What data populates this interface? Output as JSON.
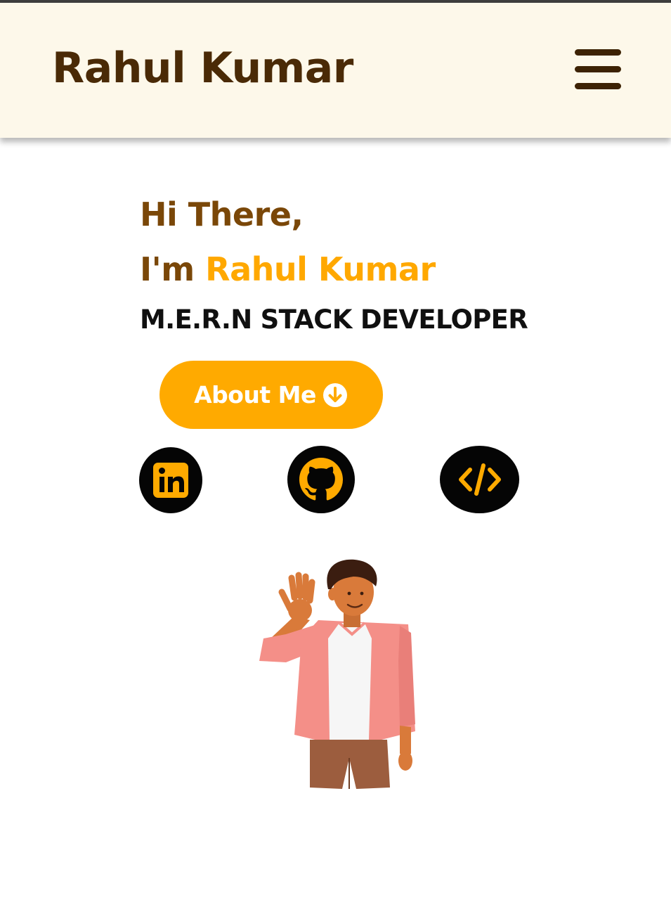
{
  "header": {
    "brand": "Rahul Kumar",
    "menu_icon": "hamburger-menu-icon"
  },
  "hero": {
    "greeting": "Hi There,",
    "intro_prefix": "I'm ",
    "name": "Rahul Kumar",
    "role": "M.E.R.N STACK DEVELOPER",
    "about_button": {
      "label": "About Me",
      "icon": "arrow-down-circle-icon"
    }
  },
  "social_links": [
    {
      "name": "linkedin",
      "icon": "linkedin-icon"
    },
    {
      "name": "github",
      "icon": "github-icon"
    },
    {
      "name": "code",
      "icon": "code-icon"
    }
  ],
  "illustration": {
    "icon": "waving-person-illustration"
  },
  "colors": {
    "accent": "#ffaa00",
    "brown_heading": "#7a4708",
    "brand": "#4a2a06",
    "navbar_bg": "#fdf8ea",
    "dark": "#050505"
  }
}
